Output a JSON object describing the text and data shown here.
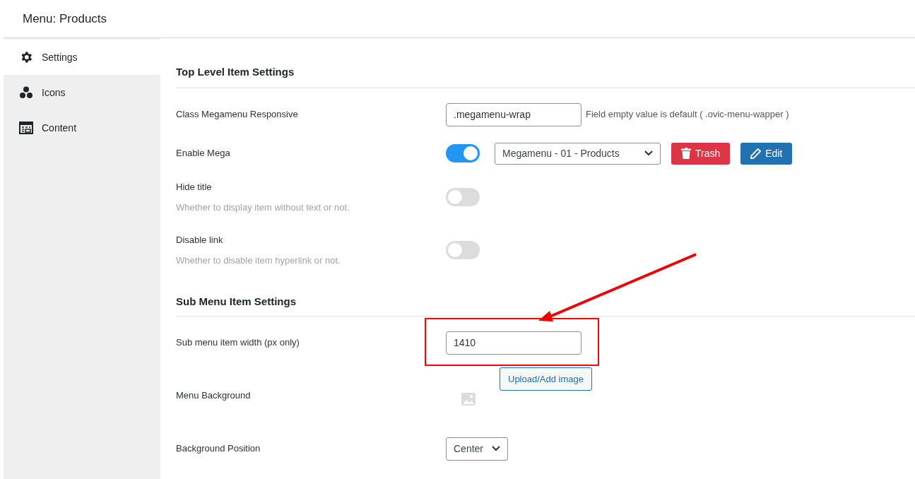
{
  "title": "Menu: Products",
  "sidebar": {
    "items": [
      {
        "label": "Settings",
        "kind": "gear",
        "selected": true
      },
      {
        "label": "Icons",
        "kind": "dots",
        "selected": false
      },
      {
        "label": "Content",
        "kind": "table",
        "selected": false
      }
    ]
  },
  "sections": [
    {
      "heading": "Top Level Item Settings",
      "rows": [
        {
          "kind": "text",
          "label": "Class Megamenu Responsive",
          "value": ".megamenu-wrap",
          "note": "Field empty value is default ( .ovic-menu-wapper )"
        },
        {
          "kind": "mega",
          "label": "Enable Mega",
          "on": true,
          "select": "Megamenu - 01 - Products",
          "buttons": [
            {
              "label": "Trash",
              "kind": "danger"
            },
            {
              "label": "Edit",
              "kind": "primary"
            }
          ]
        },
        {
          "kind": "toggle",
          "label": "Hide title",
          "description": "Whether to display item without text or not.",
          "on": false
        },
        {
          "kind": "toggle",
          "label": "Disable link",
          "description": "Whether to disable item hyperlink or not.",
          "on": false
        }
      ]
    },
    {
      "heading": "Sub Menu Item Settings",
      "rows": [
        {
          "kind": "text",
          "label": "Sub menu item width (px only)",
          "value": "1410"
        },
        {
          "kind": "image",
          "label": "Menu Background",
          "button": "Upload/Add image"
        },
        {
          "kind": "select",
          "label": "Background Position",
          "value": "Center"
        }
      ]
    }
  ]
}
